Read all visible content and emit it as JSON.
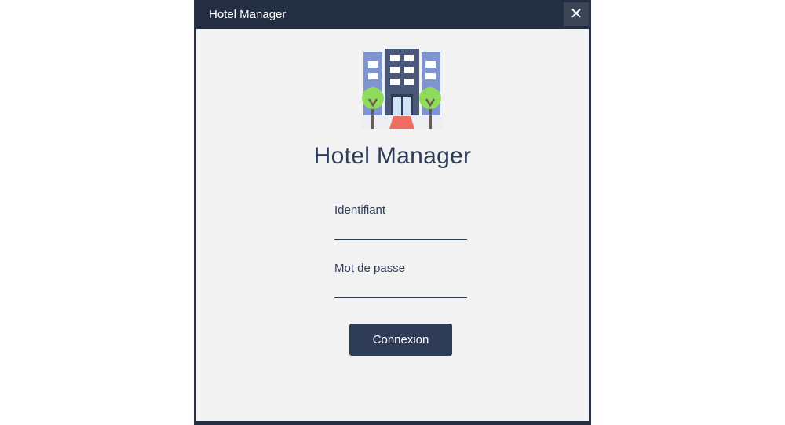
{
  "window": {
    "title": "Hotel Manager",
    "close_label": "✕"
  },
  "logo": {
    "icon": "hotel-building-icon"
  },
  "app_title": "Hotel Manager",
  "form": {
    "username_label": "Identifiant",
    "username_value": "",
    "password_label": "Mot de passe",
    "password_value": "",
    "submit_label": "Connexion"
  },
  "colors": {
    "titlebar": "#232e42",
    "primary": "#2f3c58",
    "background": "#f2f2f2"
  }
}
